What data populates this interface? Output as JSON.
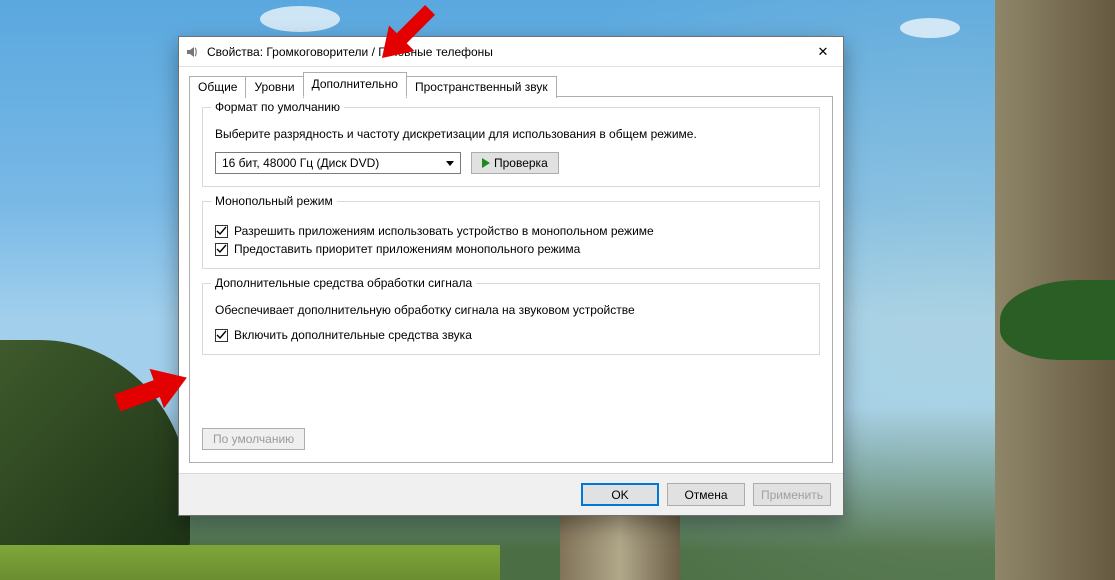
{
  "window": {
    "title": "Свойства: Громкоговорители / Головные телефоны"
  },
  "tabs": {
    "general": "Общие",
    "levels": "Уровни",
    "advanced": "Дополнительно",
    "spatial": "Пространственный звук"
  },
  "defaultFormat": {
    "legend": "Формат по умолчанию",
    "description": "Выберите разрядность и частоту дискретизации для использования в общем режиме.",
    "selected": "16 бит, 48000 Гц (Диск DVD)",
    "testLabel": "Проверка"
  },
  "exclusive": {
    "legend": "Монопольный режим",
    "allowExclusive": "Разрешить приложениям использовать устройство в монопольном режиме",
    "priorityExclusive": "Предоставить приоритет приложениям монопольного режима"
  },
  "enhancements": {
    "legend": "Дополнительные средства обработки сигнала",
    "description": "Обеспечивает дополнительную обработку сигнала на звуковом устройстве",
    "enableLabel": "Включить дополнительные средства звука"
  },
  "defaultsButton": "По умолчанию",
  "footer": {
    "ok": "OK",
    "cancel": "Отмена",
    "apply": "Применить"
  },
  "checkboxStates": {
    "allowExclusive": true,
    "priorityExclusive": true,
    "enableEnhancements": true
  }
}
